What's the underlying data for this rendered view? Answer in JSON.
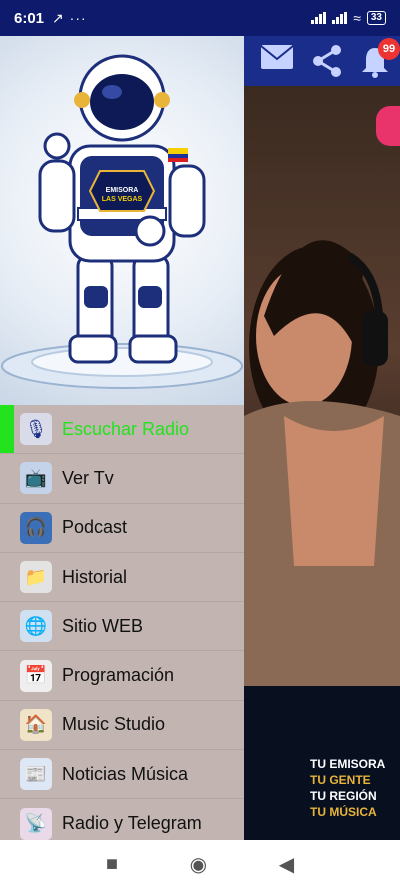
{
  "status": {
    "time": "6:01",
    "left_icons": "↗ ···",
    "battery": "33"
  },
  "toolbar": {
    "mail_icon": "mail-icon",
    "share_icon": "share-icon",
    "bell_icon": "bell-icon",
    "badge_count": "99"
  },
  "promo": {
    "line1": "TU EMISORA",
    "line2": "TU GENTE",
    "line3": "TU REGIÓN",
    "line4": "TU MÚSICA"
  },
  "header": {
    "station_line1": "EMISORA",
    "station_line2": "LAS VEGAS"
  },
  "menu": [
    {
      "label": "Escuchar Radio",
      "icon": "on-air-icon",
      "active": true
    },
    {
      "label": "Ver Tv",
      "icon": "tv-icon",
      "active": false
    },
    {
      "label": "Podcast",
      "icon": "podcast-icon",
      "active": false
    },
    {
      "label": "Historial",
      "icon": "history-icon",
      "active": false
    },
    {
      "label": "Sitio WEB",
      "icon": "www-icon",
      "active": false
    },
    {
      "label": "Programación",
      "icon": "calendar-icon",
      "active": false
    },
    {
      "label": "Music Studio",
      "icon": "music-studio-icon",
      "active": false
    },
    {
      "label": "Noticias Música",
      "icon": "news-icon",
      "active": false
    },
    {
      "label": "Radio y Telegram",
      "icon": "telegram-icon",
      "active": false
    }
  ],
  "colors": {
    "active": "#22e31d",
    "drawer_bg": "#c2b5b1",
    "status_bg": "#0e1a6b",
    "toolbar_bg": "#1a2d8a"
  }
}
